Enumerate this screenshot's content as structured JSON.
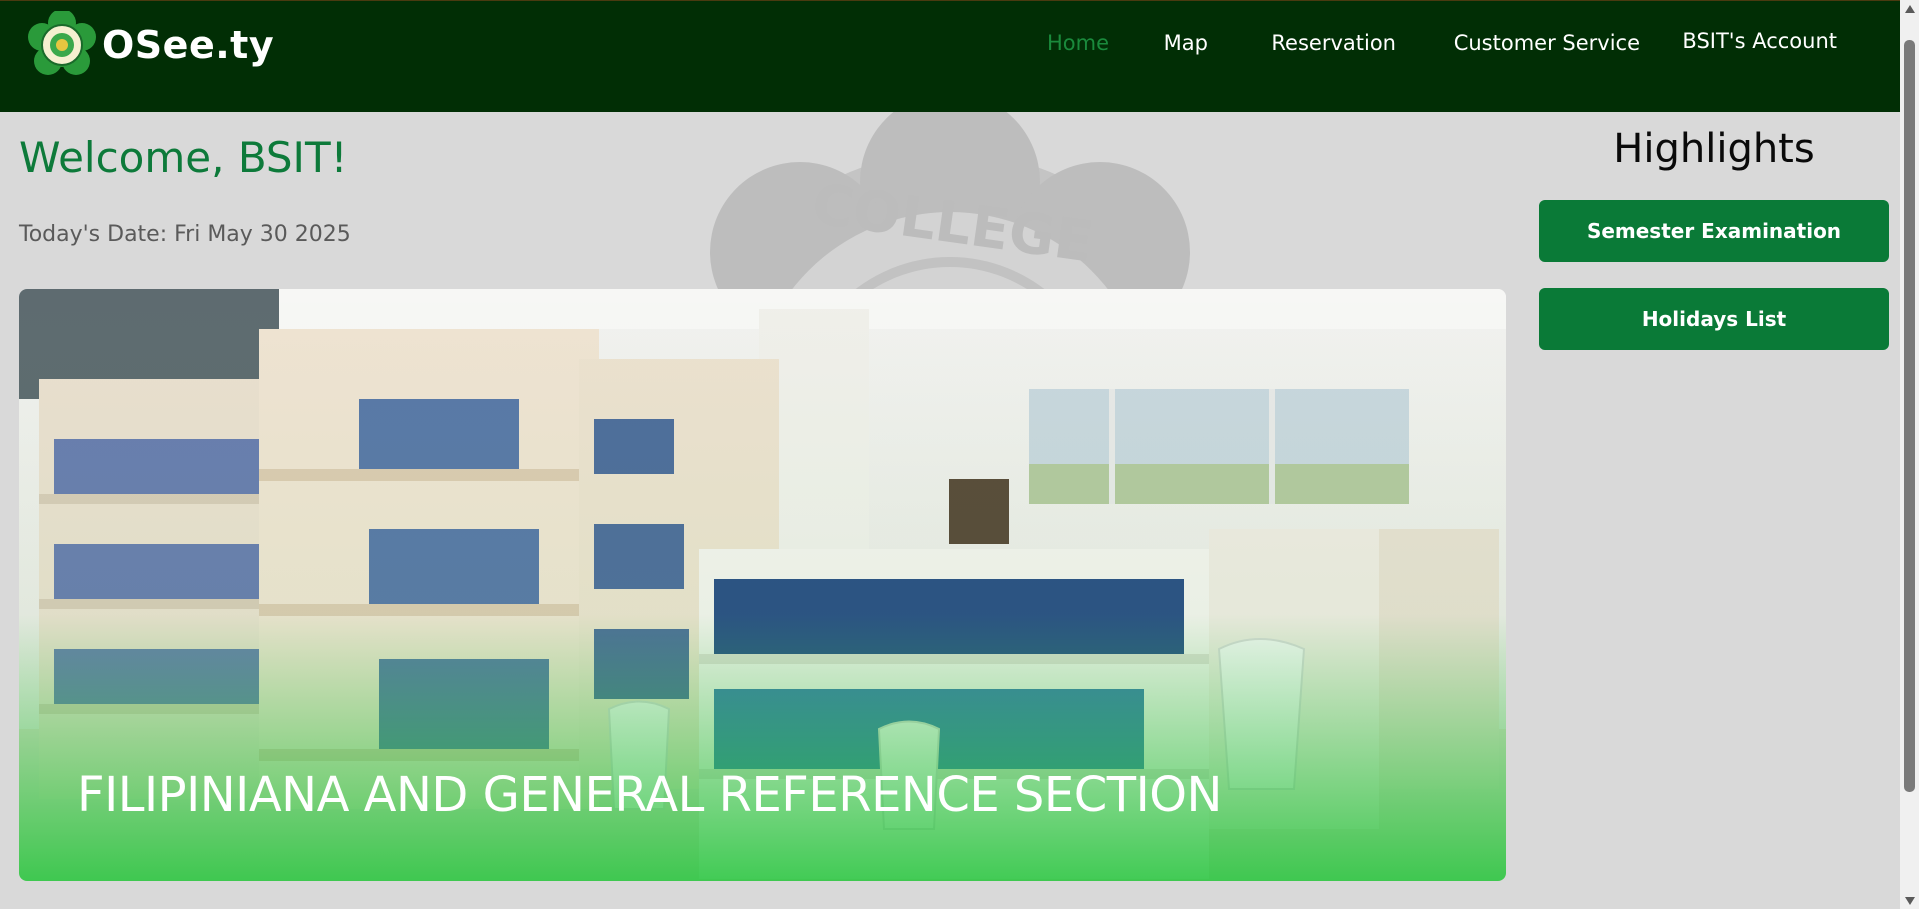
{
  "header": {
    "brand_name": "OSee.ty",
    "nav": [
      {
        "label": "Home",
        "active": true
      },
      {
        "label": "Map",
        "active": false
      },
      {
        "label": "Reservation",
        "active": false
      },
      {
        "label": "Customer Service",
        "active": false
      },
      {
        "label": "BSIT's Account",
        "active": false
      }
    ]
  },
  "watermark": {
    "text": "COLLEGE"
  },
  "main": {
    "welcome": "Welcome, BSIT!",
    "date": "Today's Date: Fri May 30 2025",
    "hero_caption": "FILIPINIANA AND GENERAL REFERENCE SECTION"
  },
  "highlights": {
    "title": "Highlights",
    "items": [
      {
        "label": "Semester Examination"
      },
      {
        "label": "Holidays List"
      }
    ]
  },
  "colors": {
    "navbar": "#012e05",
    "accent": "#0a7a37",
    "active_nav": "#1a8a3c",
    "background": "#d9d9d9"
  },
  "icons": {
    "logo": "college-seal-logo",
    "scroll_up": "chevron-up-icon",
    "scroll_down": "chevron-down-icon"
  }
}
